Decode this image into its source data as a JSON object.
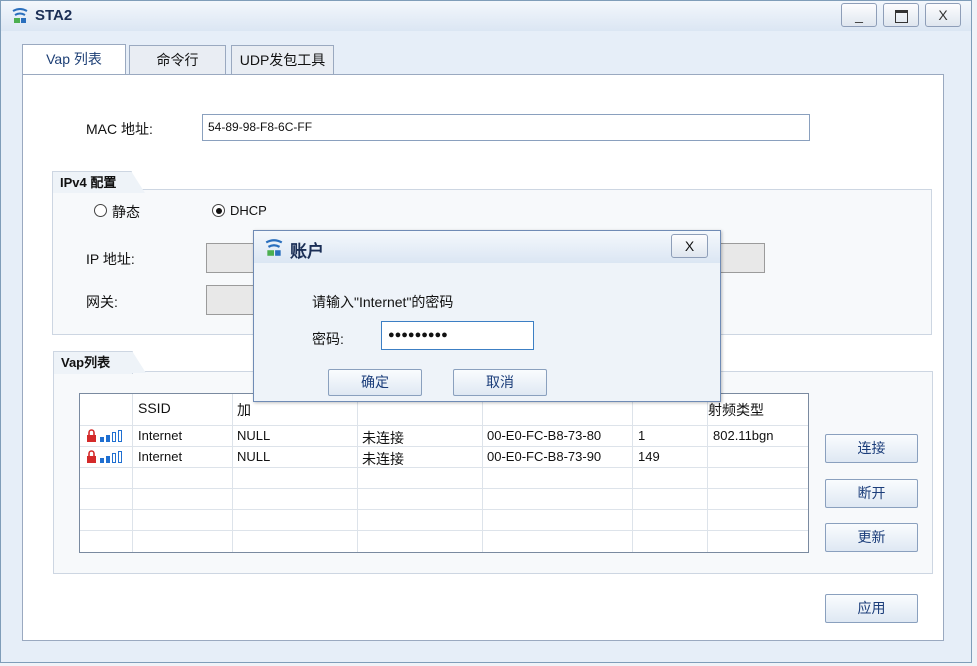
{
  "window": {
    "title": "STA2",
    "minimize": "_",
    "maximize": "▭",
    "close": "X"
  },
  "tabs": [
    {
      "label": "Vap 列表",
      "active": true
    },
    {
      "label": "命令行",
      "active": false
    },
    {
      "label": "UDP发包工具",
      "active": false
    }
  ],
  "mac": {
    "label": "MAC 地址:",
    "value": "54-89-98-F8-6C-FF"
  },
  "ipv4": {
    "title": "IPv4 配置",
    "static_label": "静态",
    "dhcp_label": "DHCP",
    "selected": "DHCP",
    "ip_label": "IP 地址:",
    "gateway_label": "网关:"
  },
  "vap": {
    "title": "Vap列表",
    "columns": [
      "SSID",
      "加",
      "",
      "",
      "",
      "射频类型"
    ],
    "rows": [
      {
        "ssid": "Internet",
        "encryption": "NULL",
        "status": "未连接",
        "bssid": "00-E0-FC-B8-73-80",
        "channel": "1",
        "radio": "802.11bgn"
      },
      {
        "ssid": "Internet",
        "encryption": "NULL",
        "status": "未连接",
        "bssid": "00-E0-FC-B8-73-90",
        "channel": "149",
        "radio": ""
      }
    ]
  },
  "buttons": {
    "connect": "连接",
    "disconnect": "断开",
    "refresh": "更新",
    "apply": "应用"
  },
  "dialog": {
    "title": "账户",
    "close": "X",
    "prompt": "请输入\"Internet\"的密码",
    "password_label": "密码:",
    "password_value": "●●●●●●●●●",
    "ok": "确定",
    "cancel": "取消"
  },
  "colors": {
    "accent": "#1b3d7a",
    "lock": "#d42a2a",
    "signal": "#1f6fd1"
  }
}
